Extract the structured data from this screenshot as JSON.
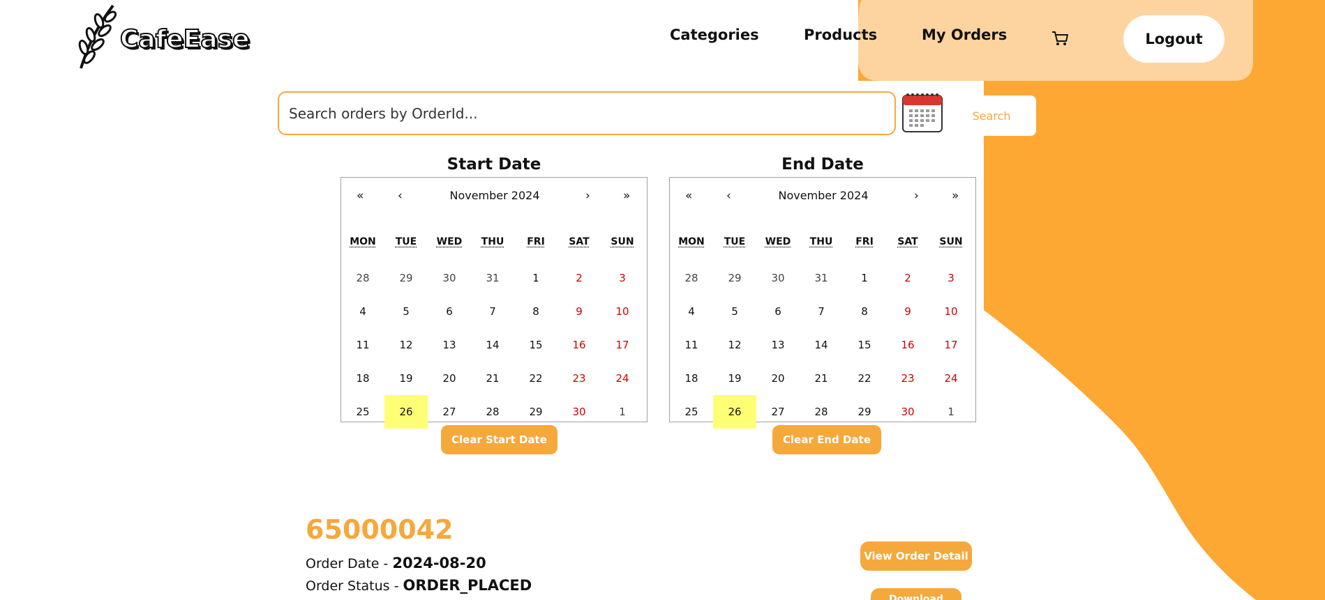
{
  "brand": {
    "name": "CafeEase"
  },
  "nav": {
    "links": [
      "Categories",
      "Products",
      "My Orders"
    ],
    "logout_label": "Logout"
  },
  "search": {
    "placeholder": "Search orders by OrderId...",
    "button_label": "Search"
  },
  "calendars": [
    {
      "title": "Start Date",
      "month_label": "November 2024",
      "clear_label": "Clear Start Date"
    },
    {
      "title": "End Date",
      "month_label": "November 2024",
      "clear_label": "Clear End Date"
    }
  ],
  "calendar_nav": {
    "first": "«",
    "prev": "‹",
    "next": "›",
    "last": "»"
  },
  "weekdays": [
    "MON",
    "TUE",
    "WED",
    "THU",
    "FRI",
    "SAT",
    "SUN"
  ],
  "weeks": [
    [
      "28",
      "29",
      "30",
      "31",
      "1",
      "2",
      "3"
    ],
    [
      "4",
      "5",
      "6",
      "7",
      "8",
      "9",
      "10"
    ],
    [
      "11",
      "12",
      "13",
      "14",
      "15",
      "16",
      "17"
    ],
    [
      "18",
      "19",
      "20",
      "21",
      "22",
      "23",
      "24"
    ],
    [
      "25",
      "26",
      "27",
      "28",
      "29",
      "30",
      "1"
    ]
  ],
  "today": "26",
  "order": {
    "id": "65000042",
    "date_label": "Order Date - ",
    "date_value": "2024-08-20",
    "status_label": "Order Status - ",
    "status_value": "ORDER_PLACED",
    "view_detail_label": "View Order Detail",
    "download_label": "Download Invoice"
  },
  "colors": {
    "accent": "#f5a83c",
    "accent_light": "#fdd49f",
    "weekend": "#d10000",
    "today": "#ffff76"
  }
}
